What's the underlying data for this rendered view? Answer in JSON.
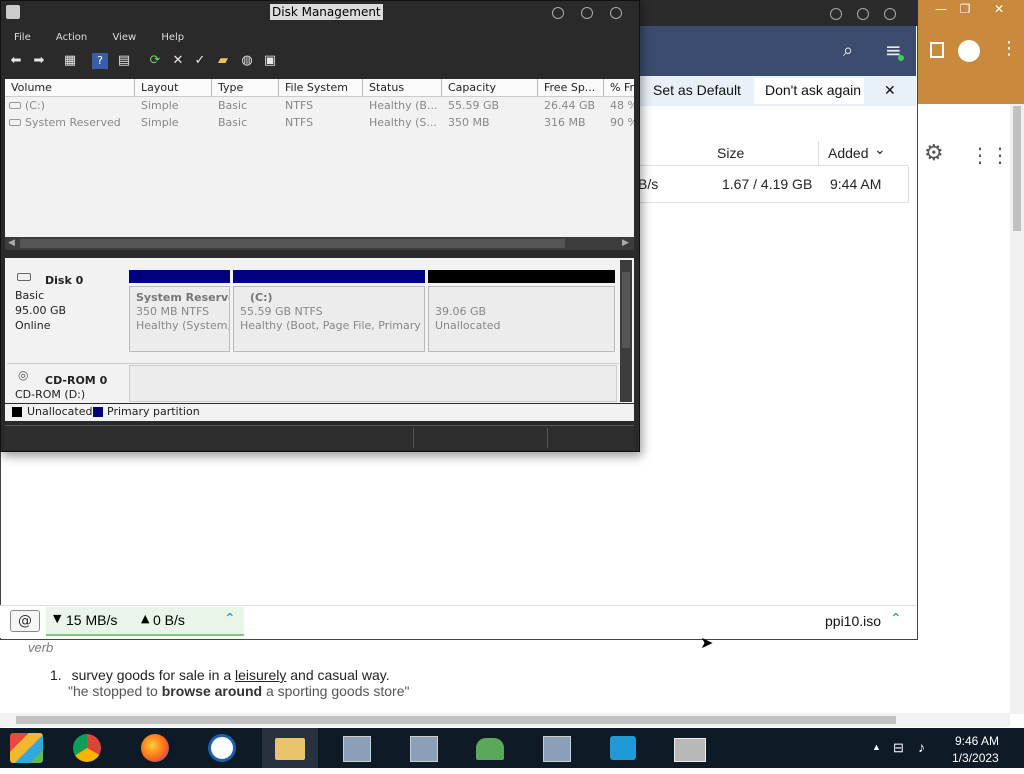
{
  "background_page": {
    "verb": "verb",
    "definition_number": "1.",
    "definition_text_prefix": "survey goods for sale in a ",
    "definition_link": "leisurely",
    "definition_text_suffix": " and casual way.",
    "example_prefix": "\"he stopped to ",
    "example_bold": "browse around",
    "example_suffix": " a sporting goods store\""
  },
  "chrome": {
    "banner": {
      "set_default": "Set as Default",
      "dont_ask": "Don't ask again",
      "close": "✕"
    },
    "table": {
      "col_size": "Size",
      "col_added": "Added",
      "sort_arrow": "⌄",
      "row_speed_tail": "B/s",
      "row_size": "1.67 / 4.19 GB",
      "row_added": "9:44 AM"
    },
    "status": {
      "down_speed": "15 MB/s",
      "up_speed": "0 B/s",
      "file": "ppi10.iso",
      "down_arrow": "▼",
      "up_arrow": "▲",
      "chevron": "⌃"
    }
  },
  "disk_management": {
    "title": "Disk Management",
    "menu": [
      "File",
      "Action",
      "View",
      "Help"
    ],
    "columns": [
      "Volume",
      "Layout",
      "Type",
      "File System",
      "Status",
      "Capacity",
      "Free Sp...",
      "% Fr"
    ],
    "volumes": [
      {
        "volume": "(C:)",
        "layout": "Simple",
        "type": "Basic",
        "fs": "NTFS",
        "status": "Healthy (B...",
        "capacity": "55.59 GB",
        "free": "26.44 GB",
        "pct": "48 %"
      },
      {
        "volume": "System Reserved",
        "layout": "Simple",
        "type": "Basic",
        "fs": "NTFS",
        "status": "Healthy (S...",
        "capacity": "350 MB",
        "free": "316 MB",
        "pct": "90 %"
      }
    ],
    "disk0": {
      "name": "Disk 0",
      "type": "Basic",
      "size": "95.00 GB",
      "state": "Online",
      "partitions": [
        {
          "name": "System Reserved",
          "size": "350 MB NTFS",
          "status": "Healthy (System,"
        },
        {
          "name": "(C:)",
          "size": "55.59 GB NTFS",
          "status": "Healthy (Boot, Page File, Primary Pa"
        },
        {
          "name": "",
          "size": "39.06 GB",
          "status": "Unallocated"
        }
      ]
    },
    "cdrom": {
      "name": "CD-ROM 0",
      "drive": "CD-ROM (D:)"
    },
    "legend": {
      "unallocated": "Unallocated",
      "primary": "Primary partition"
    }
  },
  "taskbar": {
    "time": "9:46 AM",
    "date": "1/3/2023"
  },
  "colors": {
    "primary_partition": "#00007f",
    "unallocated": "#000000",
    "taskbar": "#0e1b27",
    "chrome_header": "#3c4c6e"
  }
}
